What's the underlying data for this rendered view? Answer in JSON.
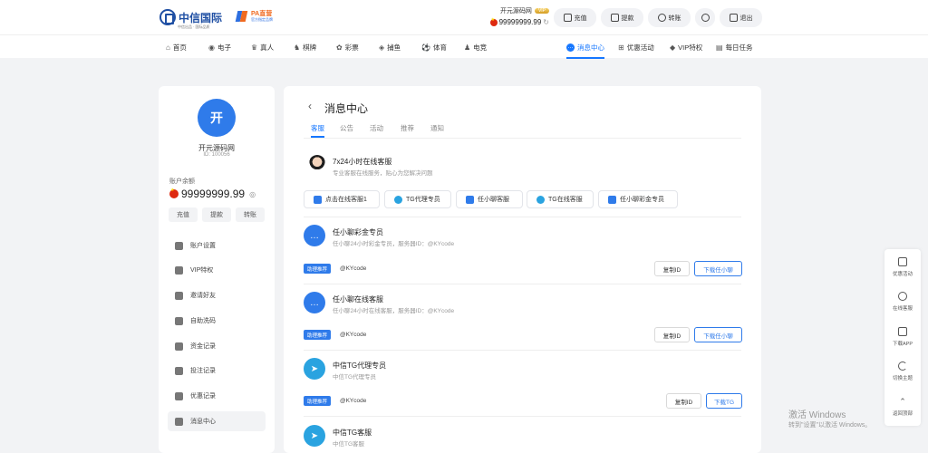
{
  "header": {
    "logo_text": "中信国际",
    "logo_sub": "中信出品 · 国际品质",
    "partner_name": "PA直营",
    "partner_sub": "官方指定品牌",
    "username": "开元源码网",
    "vip_badge": "VIP",
    "balance": "99999999.99",
    "buttons": [
      {
        "label": "充值",
        "icon": "deposit-icon"
      },
      {
        "label": "提款",
        "icon": "withdraw-icon"
      },
      {
        "label": "转账",
        "icon": "transfer-icon"
      },
      {
        "label": "",
        "icon": "user-icon"
      },
      {
        "label": "退出",
        "icon": "logout-icon"
      }
    ]
  },
  "nav": {
    "items": [
      "首页",
      "电子",
      "真人",
      "棋牌",
      "彩票",
      "捕鱼",
      "体育",
      "电竞"
    ],
    "right_items": [
      "消息中心",
      "优惠活动",
      "VIP特权",
      "每日任务"
    ]
  },
  "profile": {
    "avatar_letter": "开",
    "name": "开元源码网",
    "id_text": "ID: 100056",
    "balance_label": "账户余额",
    "balance": "99999999.99",
    "actions": [
      "充值",
      "提款",
      "转账"
    ],
    "menu": [
      "账户设置",
      "VIP特权",
      "邀请好友",
      "自助洗码",
      "资金记录",
      "投注记录",
      "优惠记录",
      "消息中心"
    ]
  },
  "main": {
    "title": "消息中心",
    "tabs": [
      "客服",
      "公告",
      "活动",
      "推荐",
      "通知"
    ],
    "service": {
      "title": "7x24小时在线客服",
      "subtitle": "专业客服在线服务，贴心为您解决问题",
      "buttons": [
        "点击在线客服1",
        "TG代理专员",
        "任小聊客服",
        "TG在线客服",
        "任小聊彩金专员"
      ]
    },
    "cards": [
      {
        "title": "任小聊彩金专员",
        "subtitle": "任小聊24小时彩金专员，服务器ID：@KYcode",
        "tag": "助理推荐",
        "handle": "@KYcode",
        "copy": "复制ID",
        "download": "下载任小聊"
      },
      {
        "title": "任小聊在线客服",
        "subtitle": "任小聊24小时在线客服，服务器ID：@KYcode",
        "tag": "助理推荐",
        "handle": "@KYcode",
        "copy": "复制ID",
        "download": "下载任小聊"
      },
      {
        "title": "中信TG代理专员",
        "subtitle": "中信TG代理专员",
        "tag": "助理推荐",
        "handle": "@KYcode",
        "copy": "复制ID",
        "download": "下载TG"
      },
      {
        "title": "中信TG客服",
        "subtitle": "中信TG客服"
      }
    ]
  },
  "float_bar": [
    "优惠活动",
    "在线客服",
    "下载APP",
    "切换主题",
    "返回顶部"
  ],
  "watermark": {
    "line1": "激活 Windows",
    "line2": "转到\"设置\"以激活 Windows。"
  }
}
